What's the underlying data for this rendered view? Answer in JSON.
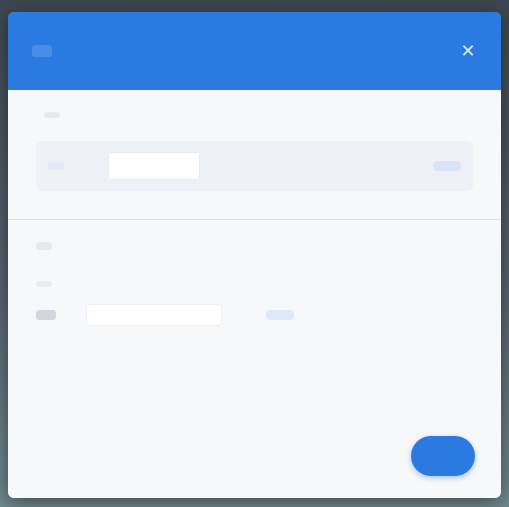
{
  "dialog": {
    "title": "",
    "close_icon": "close-icon"
  },
  "section_a": {
    "label": "",
    "chip1": "",
    "chip2": "",
    "field_value": "",
    "action": ""
  },
  "section_b": {
    "title": "",
    "field_label": "",
    "selected": "",
    "input_value": "",
    "action": ""
  },
  "footer": {
    "cancel_label": "",
    "ok_label": ""
  },
  "colors": {
    "accent": "#2a7ae2",
    "dialog_bg": "#f7f8fa"
  }
}
